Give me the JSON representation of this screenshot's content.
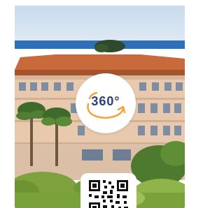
{
  "badge": {
    "label": "360°",
    "icon": "rotate-360-icon",
    "text_color": "#2a3f7e",
    "accent_color": "#f0a63a"
  },
  "qr": {
    "icon": "qr-code-icon"
  },
  "photo": {
    "subject": "building-exterior-photo"
  }
}
